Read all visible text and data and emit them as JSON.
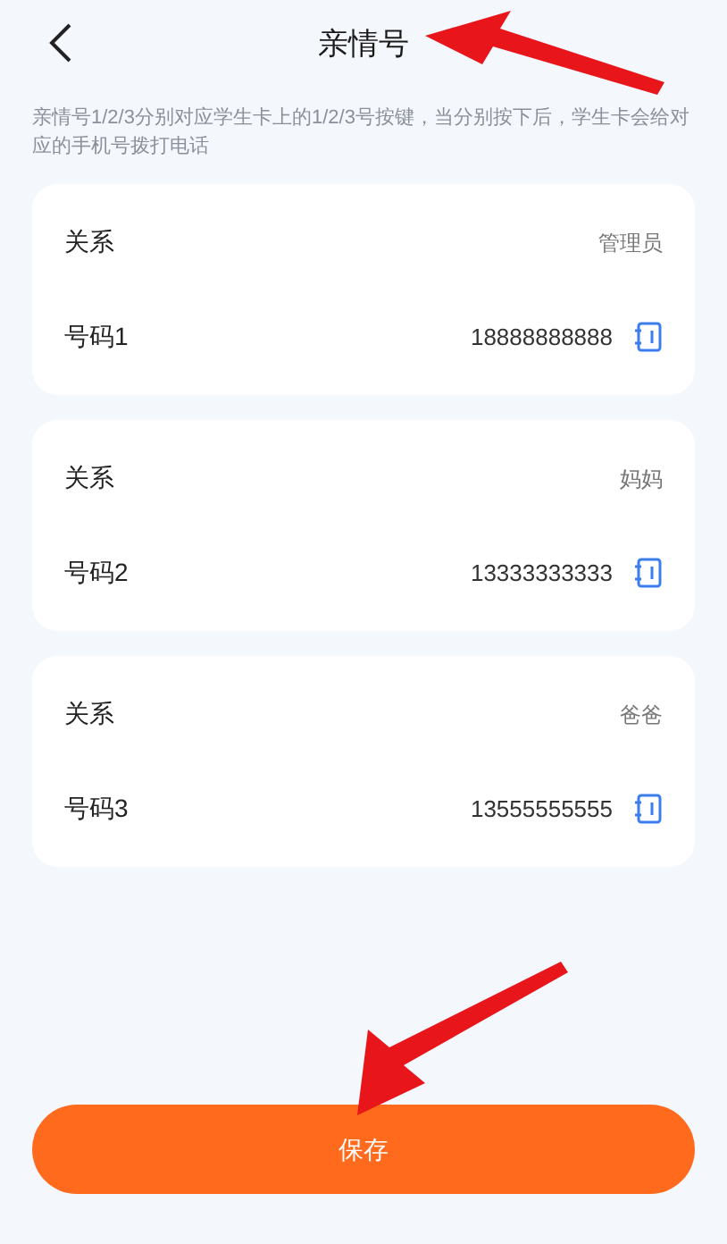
{
  "header": {
    "title": "亲情号"
  },
  "note": "亲情号1/2/3分别对应学生卡上的1/2/3号按键，当分别按下后，学生卡会给对应的手机号拨打电话",
  "contacts": [
    {
      "relation_label": "关系",
      "relation": "管理员",
      "number_label": "号码1",
      "number": "18888888888"
    },
    {
      "relation_label": "关系",
      "relation": "妈妈",
      "number_label": "号码2",
      "number": "13333333333"
    },
    {
      "relation_label": "关系",
      "relation": "爸爸",
      "number_label": "号码3",
      "number": "13555555555"
    }
  ],
  "save_button": "保存"
}
